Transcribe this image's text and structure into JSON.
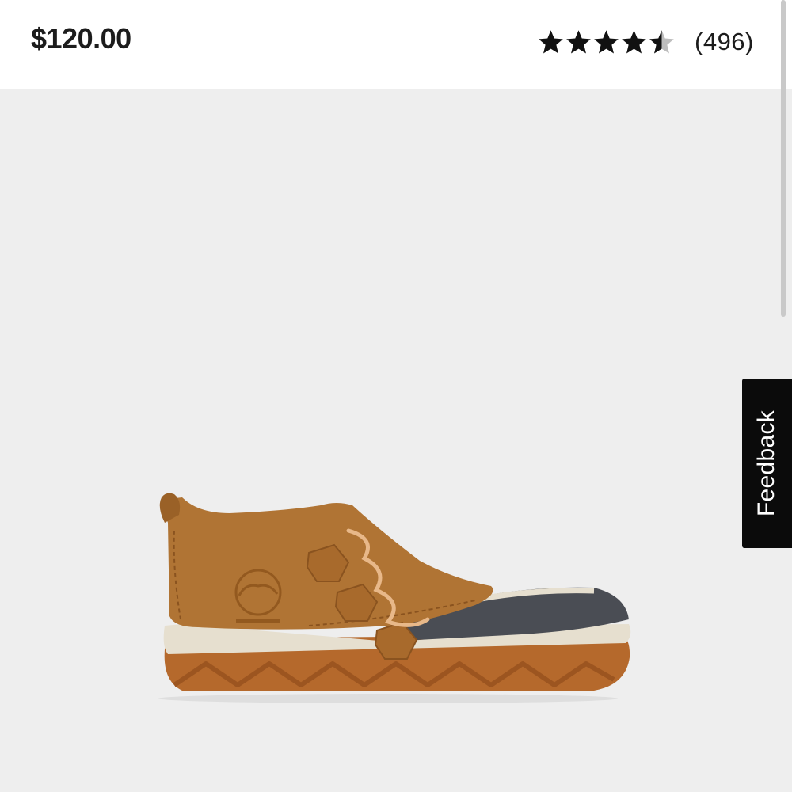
{
  "product": {
    "price": "$120.00",
    "rating": {
      "value": 4.5,
      "max": 5,
      "review_count": "(496)",
      "star_color": "#111111",
      "empty_star_color": "#bdbdbd"
    },
    "image": {
      "icon": "ankle-duck-boot-image",
      "upper_color": "#b07434",
      "shell_color": "#4a4d54",
      "midsole_color": "#e6dfcf",
      "outsole_color": "#b5692c"
    }
  },
  "feedback": {
    "label": "Feedback",
    "background": "#0b0b0b"
  },
  "colors": {
    "image_background": "#eeeeee",
    "header_background": "#ffffff"
  }
}
